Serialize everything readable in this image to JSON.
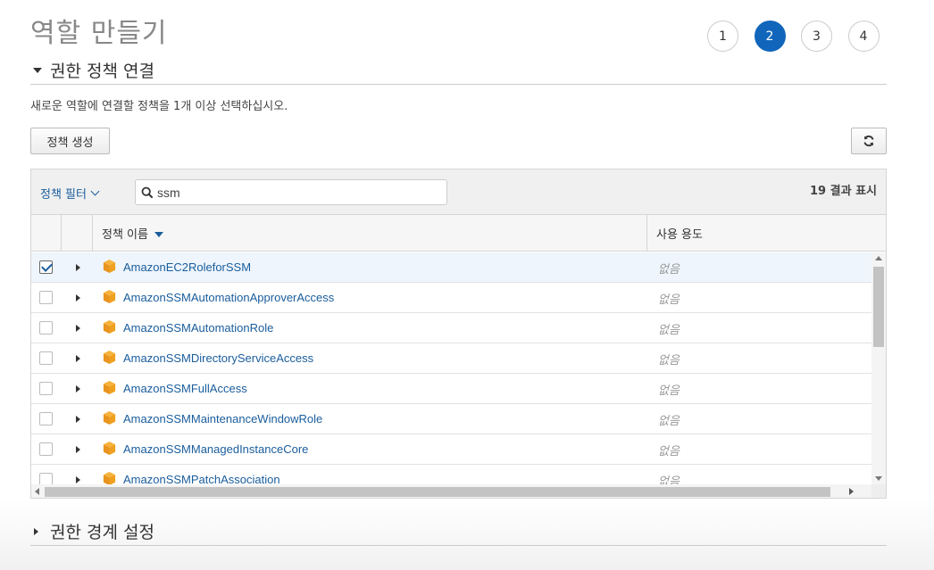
{
  "page": {
    "title": "역할 만들기"
  },
  "steps": [
    "1",
    "2",
    "3",
    "4"
  ],
  "active_step": "2",
  "section_attach": {
    "title": "권한 정책 연결",
    "description": "새로운 역할에 연결할 정책을 1개 이상 선택하십시오.",
    "create_policy_label": "정책 생성",
    "filter_label": "정책 필터",
    "search_value": "ssm",
    "result_count": "19 결과 표시",
    "columns": {
      "name": "정책 이름",
      "usage": "사용 용도"
    },
    "rows": [
      {
        "name": "AmazonEC2RoleforSSM",
        "usage": "없음",
        "checked": true
      },
      {
        "name": "AmazonSSMAutomationApproverAccess",
        "usage": "없음",
        "checked": false
      },
      {
        "name": "AmazonSSMAutomationRole",
        "usage": "없음",
        "checked": false
      },
      {
        "name": "AmazonSSMDirectoryServiceAccess",
        "usage": "없음",
        "checked": false
      },
      {
        "name": "AmazonSSMFullAccess",
        "usage": "없음",
        "checked": false
      },
      {
        "name": "AmazonSSMMaintenanceWindowRole",
        "usage": "없음",
        "checked": false
      },
      {
        "name": "AmazonSSMManagedInstanceCore",
        "usage": "없음",
        "checked": false
      },
      {
        "name": "AmazonSSMPatchAssociation",
        "usage": "없음",
        "checked": false
      }
    ]
  },
  "section_boundary": {
    "title": "권한 경계 설정"
  },
  "colors": {
    "accent": "#1166bb",
    "link": "#1a5d9c",
    "cube": "#f0a020"
  },
  "icons": {
    "search": "search-icon",
    "refresh": "refresh-icon",
    "policy": "aws-policy-cube-icon"
  }
}
